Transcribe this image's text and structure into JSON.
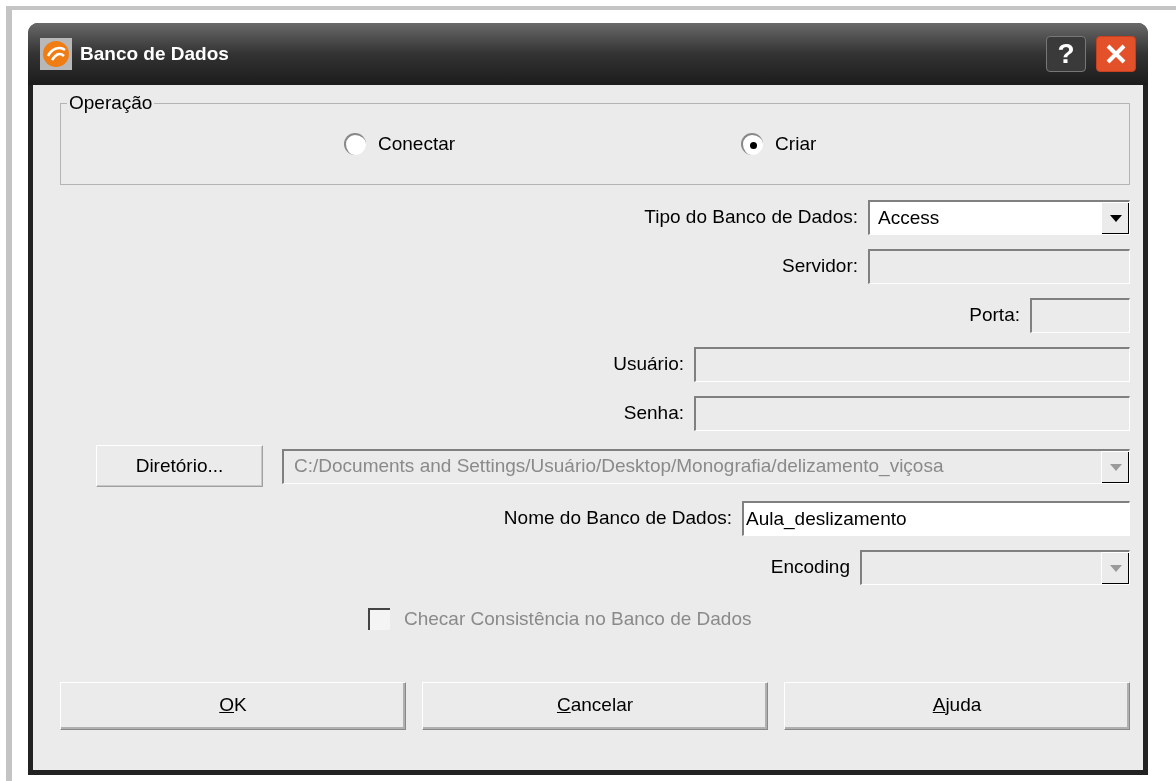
{
  "window": {
    "title": "Banco de Dados",
    "help": "?"
  },
  "operation": {
    "legend": "Operação",
    "options": [
      {
        "label": "Conectar",
        "selected": false
      },
      {
        "label": "Criar",
        "selected": true
      }
    ]
  },
  "fields": [
    {
      "kind": "select",
      "label": "Tipo do Banco de Dados:",
      "value": "Access",
      "disabled": false
    },
    {
      "kind": "text",
      "label": "Servidor:",
      "disabled": true
    },
    {
      "kind": "text",
      "label": "Porta:",
      "disabled": true
    },
    {
      "kind": "text",
      "label": "Usuário:",
      "disabled": true
    },
    {
      "kind": "text",
      "label": "Senha:",
      "disabled": true
    },
    {
      "kind": "browse",
      "button": "Diretório...",
      "value": "C:/Documents and Settings/Usuário/Desktop/Monografia/delizamento_viçosa",
      "disabled": true
    },
    {
      "kind": "text",
      "label": "Nome do Banco de Dados:",
      "value": "Aula_deslizamento",
      "disabled": false
    },
    {
      "kind": "select",
      "label": "Encoding",
      "disabled": true
    }
  ],
  "checkbox": {
    "label": "Checar Consistência no Banco de Dados",
    "checked": false,
    "disabled": true
  },
  "buttons": [
    {
      "label": "OK",
      "underline_first": true
    },
    {
      "label": "Cancelar",
      "underline_first": true
    },
    {
      "label": "Ajuda",
      "underline_first": true
    }
  ]
}
